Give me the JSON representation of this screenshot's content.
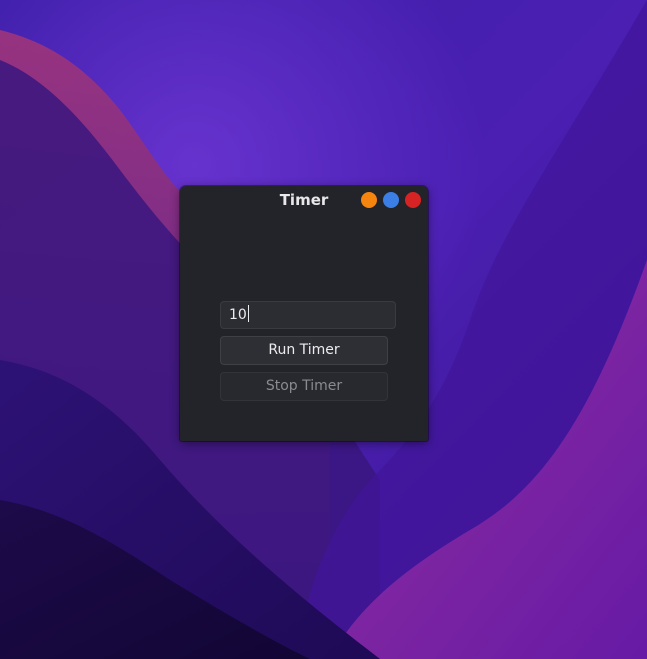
{
  "window": {
    "title": "Timer",
    "controls": {
      "minimize_color": "#f5850f",
      "maximize_color": "#3b7fe6",
      "close_color": "#d72323"
    }
  },
  "timer": {
    "seconds_value": "10",
    "run_label": "Run Timer",
    "stop_label": "Stop Timer",
    "stop_enabled": false
  },
  "colors": {
    "window_bg": "#232429",
    "desktop_accent": "#6a1fb0"
  }
}
